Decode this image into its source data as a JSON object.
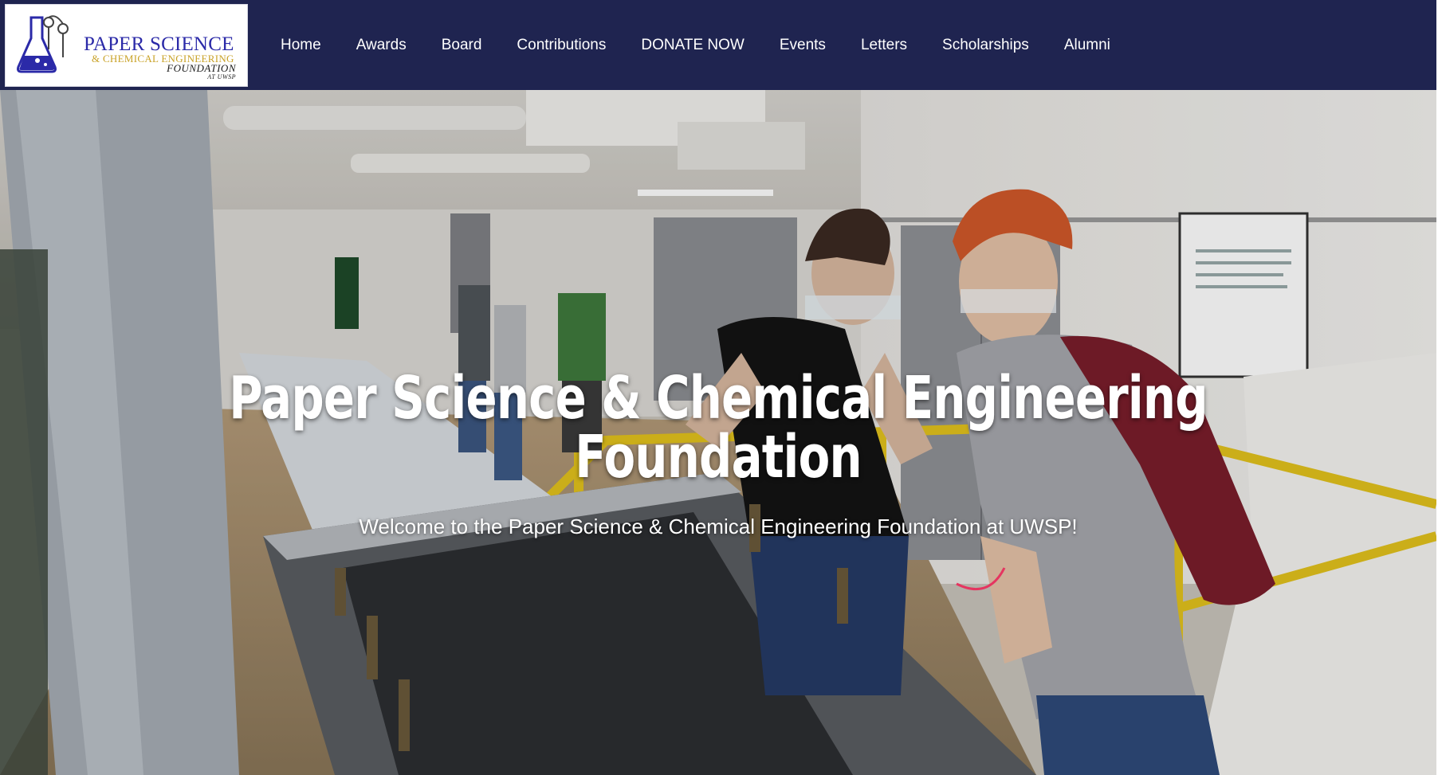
{
  "brand": {
    "logo_line1": "PAPER SCIENCE",
    "logo_line2": "& CHEMICAL ENGINEERING",
    "logo_line3": "FOUNDATION",
    "logo_line4": "AT UWSP"
  },
  "nav": {
    "items": [
      {
        "label": "Home"
      },
      {
        "label": "Awards"
      },
      {
        "label": "Board"
      },
      {
        "label": "Contributions"
      },
      {
        "label": "DONATE NOW"
      },
      {
        "label": "Events"
      },
      {
        "label": "Letters"
      },
      {
        "label": "Scholarships"
      },
      {
        "label": "Alumni"
      }
    ]
  },
  "hero": {
    "title_line1": "Paper Science & Chemical Engineering",
    "title_line2": "Foundation",
    "subtitle": "Welcome to the Paper Science & Chemical Engineering Foundation at UWSP!"
  },
  "colors": {
    "header_bg": "#1f2450",
    "nav_text": "#ffffff",
    "logo_blue": "#2b2aa8",
    "logo_gold": "#c9a227"
  }
}
